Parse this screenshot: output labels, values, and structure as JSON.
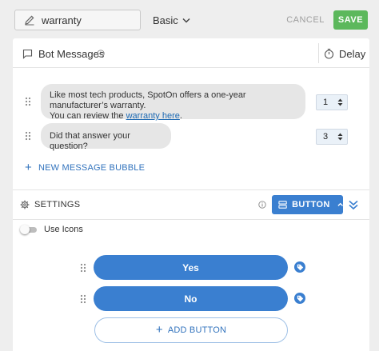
{
  "toolbar": {
    "name_value": "warranty",
    "type_value": "Basic",
    "cancel_label": "CANCEL",
    "save_label": "SAVE"
  },
  "bot_messages": {
    "title": "Bot Messages",
    "delay_label": "Delay",
    "messages": [
      {
        "text_line1": "Like most tech products, SpotOn offers a one-year manufacturer’s warranty.",
        "text_line2_prefix": "You can review the ",
        "link_text": "warranty here",
        "text_line2_suffix": ".",
        "delay": "1"
      },
      {
        "text": "Did that answer your question?",
        "delay": "3"
      }
    ],
    "new_message_label": "NEW MESSAGE BUBBLE"
  },
  "settings": {
    "label": "SETTINGS",
    "button_type_label": "BUTTON",
    "use_icons_label": "Use Icons",
    "use_icons_on": false
  },
  "responses": {
    "buttons": [
      {
        "label": "Yes"
      },
      {
        "label": "No"
      }
    ],
    "add_label": "ADD BUTTON"
  },
  "colors": {
    "accent_blue": "#3a7fd0",
    "save_green": "#5cb85c",
    "link_blue": "#1e6ab3"
  },
  "icons": [
    "pencil-icon",
    "chevron-down-icon",
    "chat-bubble-icon",
    "info-icon",
    "stopwatch-icon",
    "drag-handle-icon",
    "gear-icon",
    "button-layout-icon",
    "chevron-up-icon",
    "double-chevron-down-icon",
    "tag-icon",
    "plus-icon"
  ]
}
